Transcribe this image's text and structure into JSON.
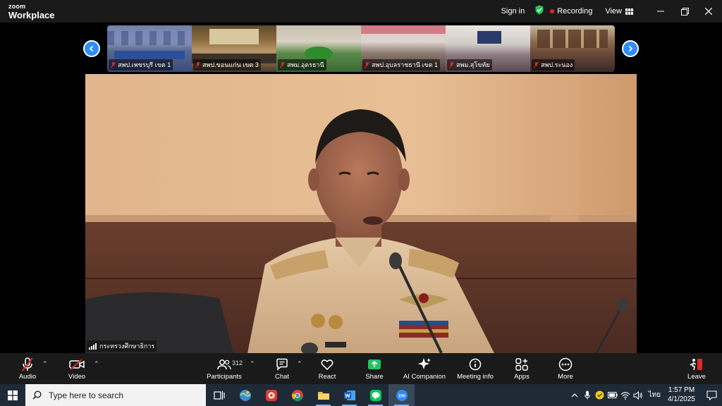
{
  "app": {
    "logo_top": "zoom",
    "logo_bottom": "Workplace",
    "sign_in": "Sign in",
    "recording": "Recording",
    "view": "View"
  },
  "gallery": {
    "tiles": [
      {
        "label": "สพป.เพชรบุรี เขต 1"
      },
      {
        "label": "สพป.ขอนแก่น เขต 3"
      },
      {
        "label": "สพม.อุดรธานี"
      },
      {
        "label": "สพป.อุบลราชธานี เขต 1"
      },
      {
        "label": "สพม.สุโขทัย"
      },
      {
        "label": "สพป.ระนอง"
      }
    ]
  },
  "main_video": {
    "label": "กระทรวงศึกษาธิการ"
  },
  "toolbar": {
    "audio": "Audio",
    "video": "Video",
    "participants": "Participants",
    "participants_count": "312",
    "chat": "Chat",
    "react": "React",
    "share": "Share",
    "ai_companion": "AI Companion",
    "meeting_info": "Meeting info",
    "apps": "Apps",
    "more": "More",
    "leave": "Leave"
  },
  "taskbar": {
    "search_placeholder": "Type here to search",
    "language": "ไทย",
    "time": "1:57 PM",
    "date": "4/1/2025"
  },
  "colors": {
    "accent_blue": "#2d8cff",
    "share_green": "#22c55e",
    "recording_red": "#e02828",
    "leave_red": "#e02828"
  }
}
